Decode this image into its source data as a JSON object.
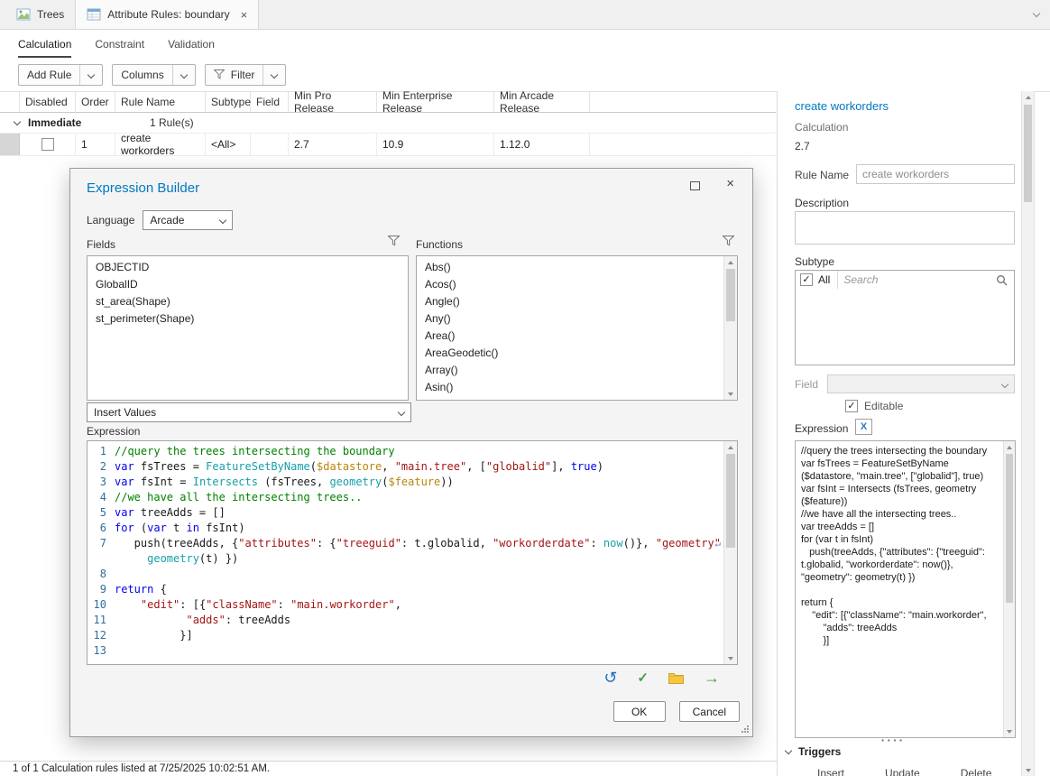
{
  "icons": {
    "close": "×",
    "undo": "↺",
    "check": "✓",
    "forward": "→",
    "wrap": "↵",
    "expression_clear": "X"
  },
  "window": {
    "view_tabs": [
      {
        "label": "Trees"
      },
      {
        "label": "Attribute Rules: boundary"
      }
    ]
  },
  "subtabs": [
    "Calculation",
    "Constraint",
    "Validation"
  ],
  "toolbar": {
    "add_rule": "Add Rule",
    "columns": "Columns",
    "filter": "Filter"
  },
  "rules_table": {
    "headers": [
      "Disabled",
      "Order",
      "Rule Name",
      "Subtype",
      "Field",
      "Min Pro Release",
      "Min Enterprise Release",
      "Min Arcade Release"
    ],
    "group_label": "Immediate",
    "group_count": "1 Rule(s)",
    "row": {
      "order": "1",
      "rule_name": "create workorders",
      "subtype": "<All>",
      "field": "",
      "min_pro": "2.7",
      "min_enterprise": "10.9",
      "min_arcade": "1.12.0"
    }
  },
  "dialog": {
    "title": "Expression Builder",
    "language_label": "Language",
    "language_value": "Arcade",
    "fields_label": "Fields",
    "functions_label": "Functions",
    "fields": [
      "OBJECTID",
      "GlobalID",
      "st_area(Shape)",
      "st_perimeter(Shape)"
    ],
    "functions": [
      "Abs()",
      "Acos()",
      "Angle()",
      "Any()",
      "Area()",
      "AreaGeodetic()",
      "Array()",
      "Asin()"
    ],
    "insert_values_label": "Insert Values",
    "expression_label": "Expression",
    "ok_label": "OK",
    "cancel_label": "Cancel",
    "editor_lines": [
      {
        "n": "1",
        "tokens": [
          {
            "t": "//query the trees intersecting the boundary",
            "c": "cm"
          }
        ]
      },
      {
        "n": "2",
        "tokens": [
          {
            "t": "var",
            "c": "kw"
          },
          {
            "t": " fsTrees = ",
            "c": "pl"
          },
          {
            "t": "FeatureSetByName",
            "c": "fn"
          },
          {
            "t": "(",
            "c": "pl"
          },
          {
            "t": "$datastore",
            "c": "gv"
          },
          {
            "t": ", ",
            "c": "pl"
          },
          {
            "t": "\"main.tree\"",
            "c": "str"
          },
          {
            "t": ", [",
            "c": "pl"
          },
          {
            "t": "\"globalid\"",
            "c": "str"
          },
          {
            "t": "], ",
            "c": "pl"
          },
          {
            "t": "true",
            "c": "kw"
          },
          {
            "t": ")",
            "c": "pl"
          }
        ]
      },
      {
        "n": "3",
        "tokens": [
          {
            "t": "var",
            "c": "kw"
          },
          {
            "t": " fsInt = ",
            "c": "pl"
          },
          {
            "t": "Intersects",
            "c": "fn"
          },
          {
            "t": " (fsTrees, ",
            "c": "pl"
          },
          {
            "t": "geometry",
            "c": "fn"
          },
          {
            "t": "(",
            "c": "pl"
          },
          {
            "t": "$feature",
            "c": "gv"
          },
          {
            "t": "))",
            "c": "pl"
          }
        ]
      },
      {
        "n": "4",
        "tokens": [
          {
            "t": "//we have all the intersecting trees..",
            "c": "cm"
          }
        ]
      },
      {
        "n": "5",
        "tokens": [
          {
            "t": "var",
            "c": "kw"
          },
          {
            "t": " treeAdds = []",
            "c": "pl"
          }
        ]
      },
      {
        "n": "6",
        "tokens": [
          {
            "t": "for",
            "c": "kw"
          },
          {
            "t": " (",
            "c": "pl"
          },
          {
            "t": "var",
            "c": "kw"
          },
          {
            "t": " t ",
            "c": "pl"
          },
          {
            "t": "in",
            "c": "kw"
          },
          {
            "t": " fsInt)",
            "c": "pl"
          }
        ]
      },
      {
        "n": "7",
        "wrap": true,
        "tokens": [
          {
            "t": "   push(treeAdds, {",
            "c": "pl"
          },
          {
            "t": "\"attributes\"",
            "c": "str"
          },
          {
            "t": ": {",
            "c": "pl"
          },
          {
            "t": "\"treeguid\"",
            "c": "str"
          },
          {
            "t": ": t.globalid, ",
            "c": "pl"
          },
          {
            "t": "\"workorderdate\"",
            "c": "str"
          },
          {
            "t": ": ",
            "c": "pl"
          },
          {
            "t": "now",
            "c": "fn"
          },
          {
            "t": "()}, ",
            "c": "pl"
          },
          {
            "t": "\"geometry\"",
            "c": "str"
          },
          {
            "t": ": ",
            "c": "pl"
          }
        ]
      },
      {
        "n": "",
        "tokens": [
          {
            "t": "     ",
            "c": "pl"
          },
          {
            "t": "geometry",
            "c": "fn"
          },
          {
            "t": "(t) })",
            "c": "pl"
          }
        ]
      },
      {
        "n": "8",
        "tokens": []
      },
      {
        "n": "9",
        "tokens": [
          {
            "t": "return",
            "c": "kw"
          },
          {
            "t": " {",
            "c": "pl"
          }
        ]
      },
      {
        "n": "10",
        "tokens": [
          {
            "t": "    ",
            "c": "pl"
          },
          {
            "t": "\"edit\"",
            "c": "str"
          },
          {
            "t": ": [{",
            "c": "pl"
          },
          {
            "t": "\"className\"",
            "c": "str"
          },
          {
            "t": ": ",
            "c": "pl"
          },
          {
            "t": "\"main.workorder\"",
            "c": "str"
          },
          {
            "t": ",",
            "c": "pl"
          }
        ]
      },
      {
        "n": "11",
        "tokens": [
          {
            "t": "           ",
            "c": "pl"
          },
          {
            "t": "\"adds\"",
            "c": "str"
          },
          {
            "t": ": treeAdds",
            "c": "pl"
          }
        ]
      },
      {
        "n": "12",
        "tokens": [
          {
            "t": "          }]",
            "c": "pl"
          }
        ]
      },
      {
        "n": "13",
        "tokens": []
      }
    ]
  },
  "side_panel": {
    "title": "create workorders",
    "type_label": "Calculation",
    "min_version": "2.7",
    "rule_name_label": "Rule Name",
    "rule_name_value": "create workorders",
    "description_label": "Description",
    "subtype_label": "Subtype",
    "subtype_all_label": "All",
    "search_placeholder": "Search",
    "field_label": "Field",
    "editable_label": "Editable",
    "expression_label": "Expression",
    "expression_preview": "//query the trees intersecting the boundary\nvar fsTrees = FeatureSetByName ($datastore, \"main.tree\", [\"globalid\"], true)\nvar fsInt = Intersects (fsTrees, geometry ($feature))\n//we have all the intersecting trees..\nvar treeAdds = []\nfor (var t in fsInt)\n   push(treeAdds, {\"attributes\": {\"treeguid\": t.globalid, \"workorderdate\": now()}, \"geometry\": geometry(t) })\n\nreturn {\n    \"edit\": [{\"className\": \"main.workorder\",\n        \"adds\": treeAdds\n        }]",
    "triggers_label": "Triggers",
    "trigger_options": [
      "Insert",
      "Update",
      "Delete"
    ]
  },
  "status_bar": "1 of 1 Calculation rules listed at 7/25/2025 10:02:51 AM."
}
